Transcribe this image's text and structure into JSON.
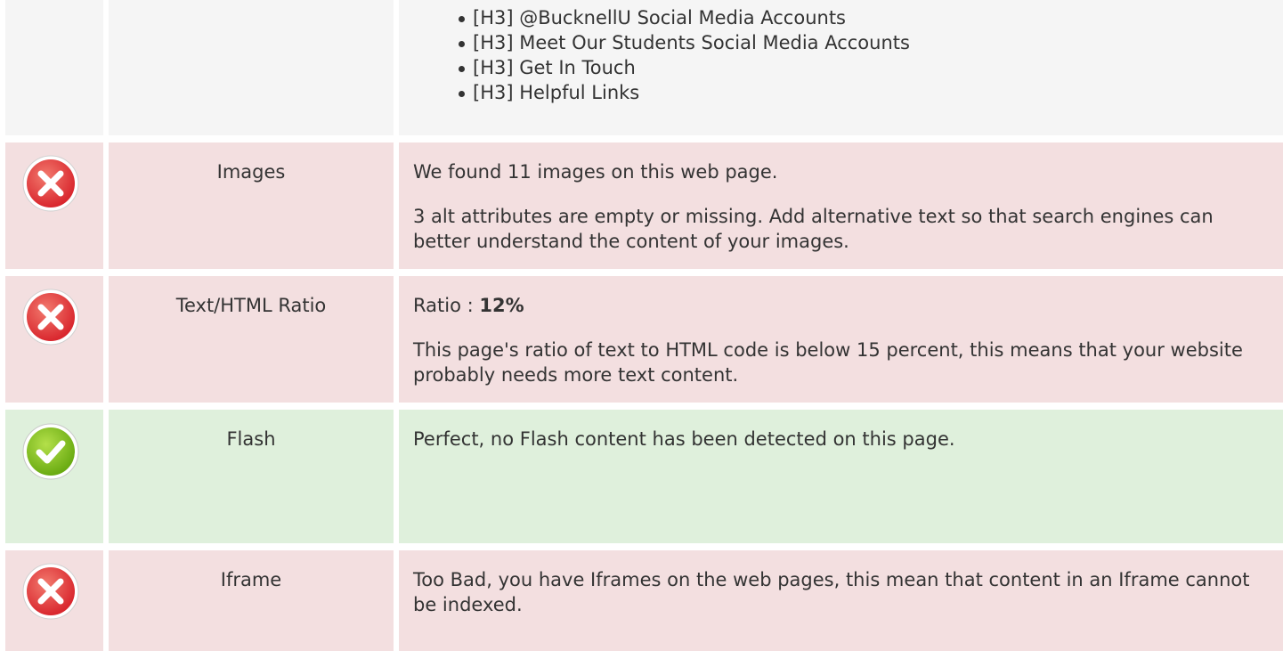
{
  "headings_section": {
    "items": [
      "[H3] @BucknellU Social Media Accounts",
      "[H3] Meet Our Students Social Media Accounts",
      "[H3] Get In Touch",
      "[H3] Helpful Links"
    ]
  },
  "images": {
    "label": "Images",
    "status": "error",
    "status_icon": "error-x-icon",
    "line1": "We found 11 images on this web page.",
    "line2": "3 alt attributes are empty or missing. Add alternative text so that search engines can better understand the content of your images."
  },
  "text_html_ratio": {
    "label": "Text/HTML Ratio",
    "status": "error",
    "status_icon": "error-x-icon",
    "ratio_label": "Ratio : ",
    "ratio_value": "12%",
    "description": "This page's ratio of text to HTML code is below 15 percent, this means that your website probably needs more text content."
  },
  "flash": {
    "label": "Flash",
    "status": "ok",
    "status_icon": "check-icon",
    "description": "Perfect, no Flash content has been detected on this page."
  },
  "iframe": {
    "label": "Iframe",
    "status": "error",
    "status_icon": "error-x-icon",
    "description": "Too Bad, you have Iframes on the web pages, this mean that content in an Iframe cannot be indexed."
  },
  "colors": {
    "error_bg": "#f3dfe0",
    "ok_bg": "#dff0dc",
    "neutral_bg": "#f5f5f5",
    "error_icon": "#e0393e",
    "ok_icon": "#7cc017"
  }
}
